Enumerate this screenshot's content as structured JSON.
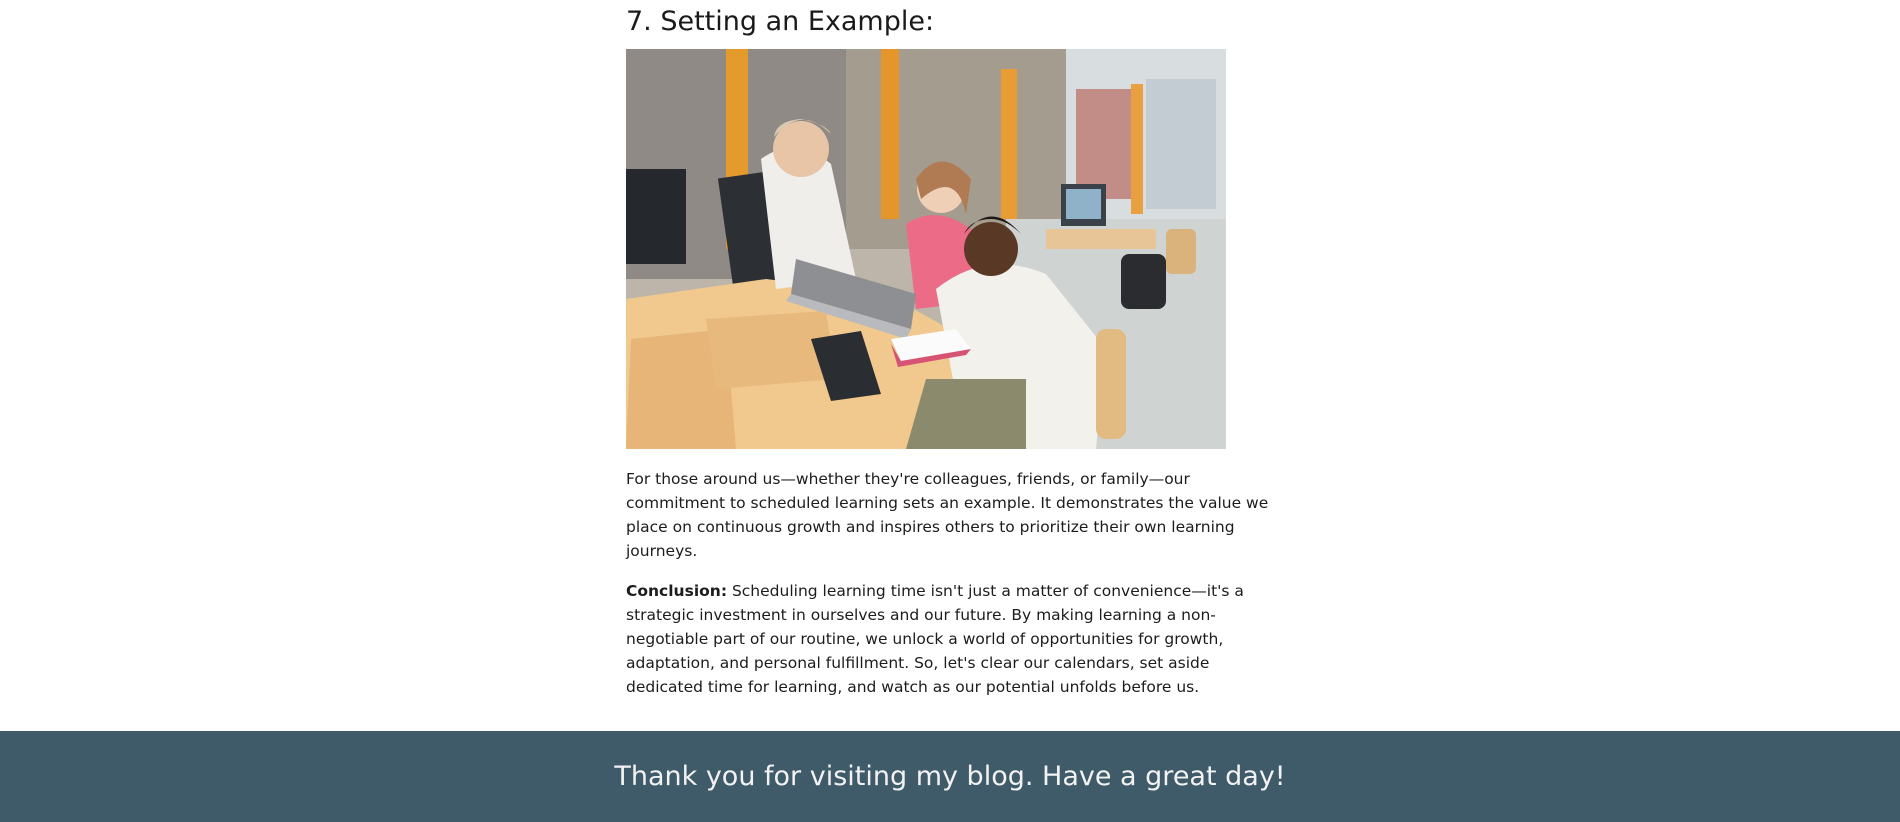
{
  "article": {
    "section_heading": "7. Setting an Example:",
    "photo_alt": "Students collaborating around a laptop in a computer lab",
    "paragraph_1": "For those around us—whether they're colleagues, friends, or family—our commitment to scheduled learning sets an example. It demonstrates the value we place on continuous growth and inspires others to prioritize their own learning journeys.",
    "conclusion_label": "Conclusion:",
    "conclusion_text": " Scheduling learning time isn't just a matter of convenience—it's a strategic investment in ourselves and our future. By making learning a non-negotiable part of our routine, we unlock a world of opportunities for growth, adaptation, and personal fulfillment. So, let's clear our calendars, set aside dedicated time for learning, and watch as our potential unfolds before us."
  },
  "footer": {
    "message": "Thank you for visiting my blog. Have a great day!"
  },
  "colors": {
    "footer_background": "#3f5a68",
    "footer_text": "#f2f2f2",
    "body_text": "#1c1c1c"
  }
}
